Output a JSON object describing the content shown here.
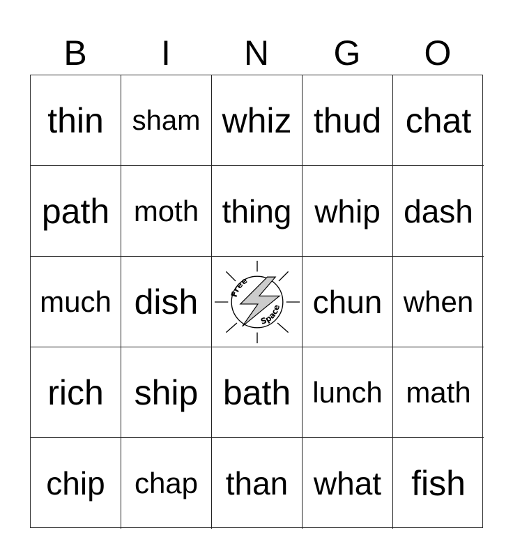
{
  "header": {
    "letters": [
      "B",
      "I",
      "N",
      "G",
      "O"
    ]
  },
  "grid": {
    "rows": [
      [
        "thin",
        "sham",
        "whiz",
        "thud",
        "chat"
      ],
      [
        "path",
        "moth",
        "thing",
        "whip",
        "dash"
      ],
      [
        "much",
        "dish",
        null,
        "chun",
        "when"
      ],
      [
        "rich",
        "ship",
        "bath",
        "lunch",
        "math"
      ],
      [
        "chip",
        "chap",
        "than",
        "what",
        "fish"
      ]
    ],
    "free_space": {
      "line1": "Free",
      "line2": "Space",
      "icon": "lightning-bolt-icon",
      "bolt_color": "#cccccc"
    }
  }
}
